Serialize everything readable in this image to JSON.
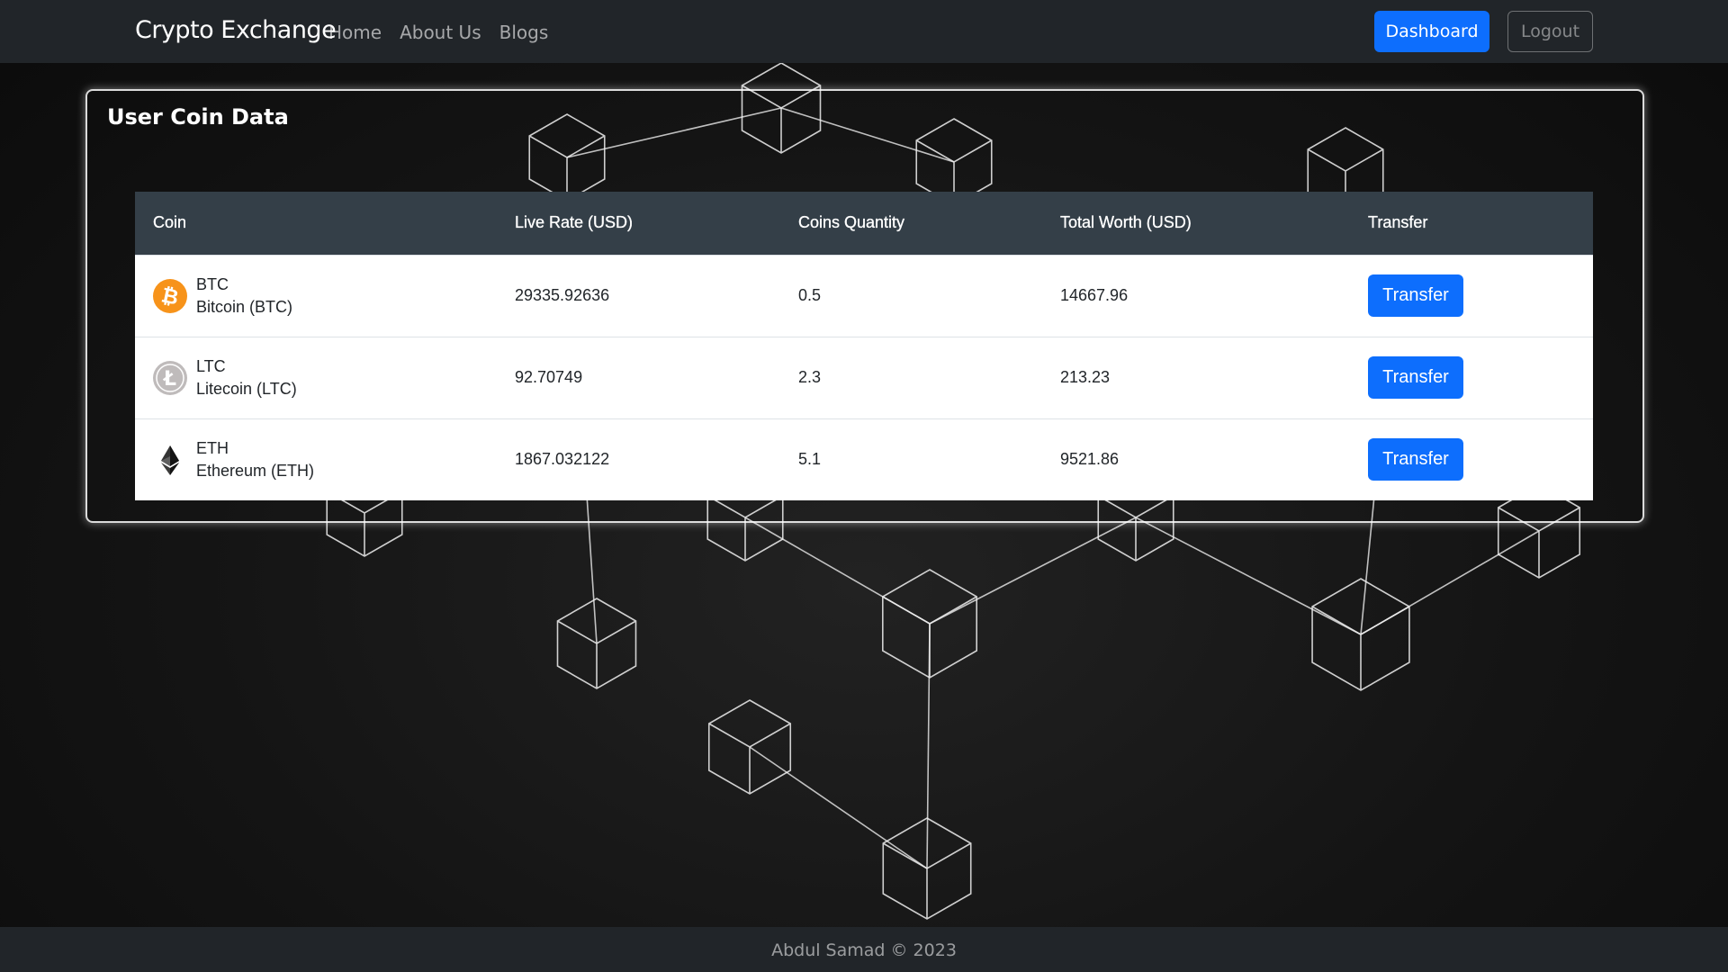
{
  "navbar": {
    "brand": "Crypto Exchange",
    "links": [
      "Home",
      "About Us",
      "Blogs"
    ],
    "dashboard_label": "Dashboard",
    "logout_label": "Logout"
  },
  "card": {
    "title": "User Coin Data"
  },
  "table": {
    "headers": [
      "Coin",
      "Live Rate (USD)",
      "Coins Quantity",
      "Total Worth (USD)",
      "Transfer"
    ],
    "rows": [
      {
        "symbol": "BTC",
        "name": "Bitcoin (BTC)",
        "icon": "bitcoin-icon",
        "rate": "29335.92636",
        "quantity": "0.5",
        "worth": "14667.96",
        "action": "Transfer"
      },
      {
        "symbol": "LTC",
        "name": "Litecoin (LTC)",
        "icon": "litecoin-icon",
        "rate": "92.70749",
        "quantity": "2.3",
        "worth": "213.23",
        "action": "Transfer"
      },
      {
        "symbol": "ETH",
        "name": "Ethereum (ETH)",
        "icon": "ethereum-icon",
        "rate": "1867.032122",
        "quantity": "5.1",
        "worth": "9521.86",
        "action": "Transfer"
      }
    ]
  },
  "footer": {
    "text": "Abdul Samad © 2023"
  },
  "colors": {
    "navbar_bg": "#212529",
    "primary": "#0d6efd",
    "table_header_bg": "#343f48",
    "bitcoin": "#f7931a",
    "litecoin": "#bfbbbb"
  }
}
